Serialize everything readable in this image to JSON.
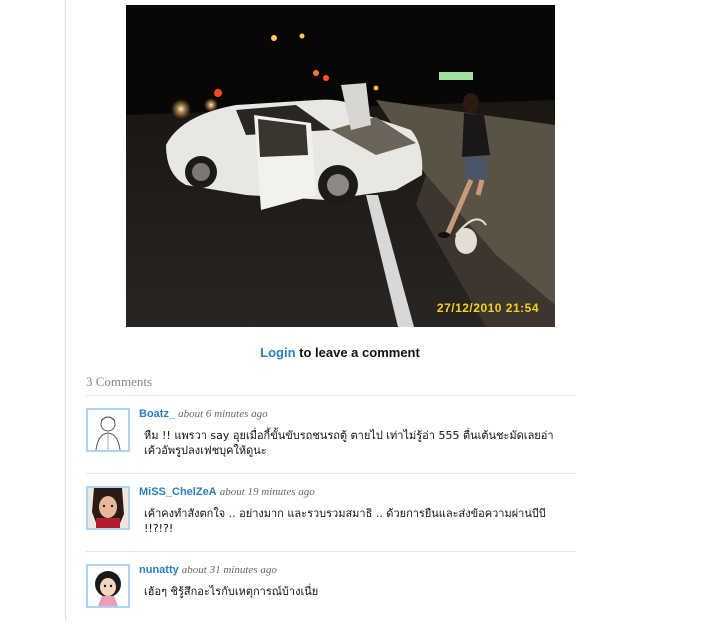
{
  "photo": {
    "name": "car-crash-photo",
    "timestamp": "27/12/2010 21:54"
  },
  "login": {
    "link_label": "Login",
    "suffix": " to leave a comment"
  },
  "comments": {
    "heading": "3 Comments",
    "items": [
      {
        "author": "Boatz_",
        "time": "about 6 minutes ago",
        "text": "หืม !! แพรวา say อุยเมื่อกี้ขั้นขับรถชนรถตู้ ตายไป เท่าไม่รู้อ่า 555 ตื่นเต้นชะมัดเลยอ่า เค้วอัพรูปลงเฟชบุคให้ดูนะ",
        "avatar": "sketch-boy-avatar"
      },
      {
        "author": "MiSS_ChelZeA",
        "time": "about 19 minutes ago",
        "text": "เค้าคงทำสังตกใจ .. อย่างมาก และรวบรวมสมาธิ .. ด้วยการยืนและส่งข้อความผ่านบีบี !!?!?!",
        "avatar": "girl-photo-avatar"
      },
      {
        "author": "nunatty",
        "time": "about 31 minutes ago",
        "text": "เฮ้อๆ ชิรู้สึกอะไรกับเหตุการณ์บ้างเนี่ย",
        "avatar": "cartoon-girl-avatar"
      }
    ]
  }
}
